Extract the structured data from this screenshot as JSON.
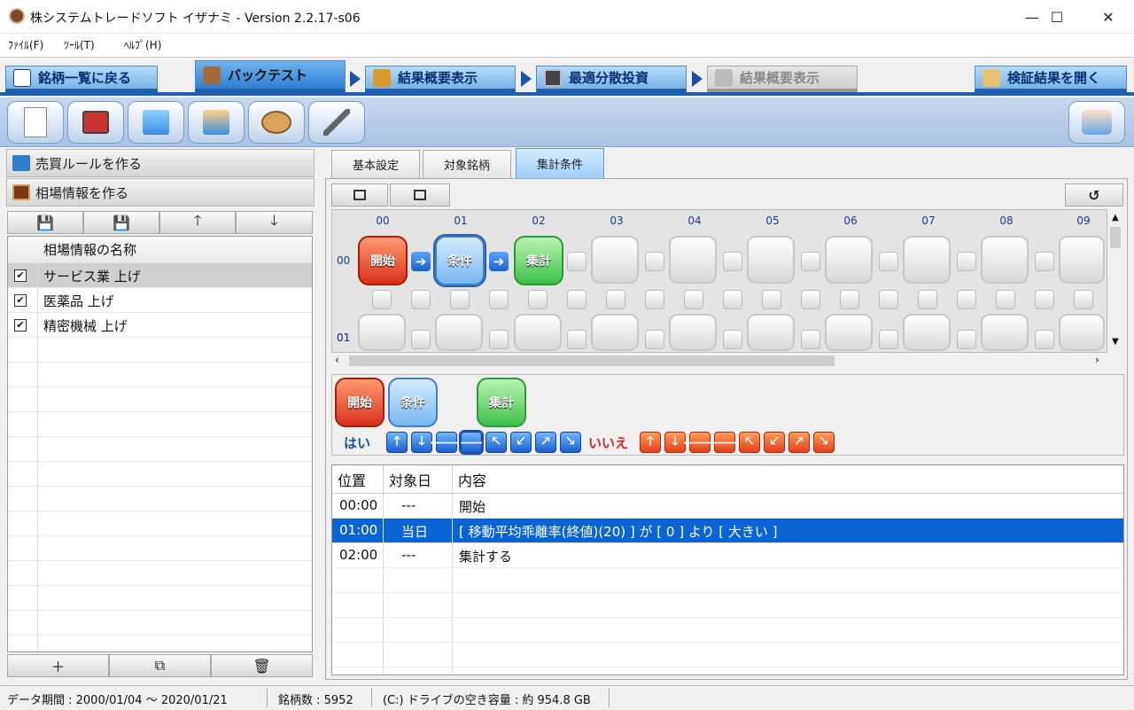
{
  "window": {
    "title": "株システムトレードソフト イザナミ - Version 2.2.17-s06",
    "minimize": "—",
    "maximize": "☐",
    "close": "✕"
  },
  "menu": [
    "ﾌｧｲﾙ(F)",
    "ﾂｰﾙ(T)",
    "ﾍﾙﾌﾟ(H)"
  ],
  "top_tabs": [
    {
      "label": "銘柄一覧に戻る",
      "state": "normal"
    },
    {
      "label": "バックテスト",
      "state": "active"
    },
    {
      "label": "結果概要表示",
      "state": "normal"
    },
    {
      "label": "最適分散投資",
      "state": "normal"
    },
    {
      "label": "結果概要表示",
      "state": "disabled"
    },
    {
      "label": "検証結果を開く",
      "state": "normal"
    }
  ],
  "toolbar": {
    "icons": [
      "new-document-icon",
      "export-icon",
      "upload-icon",
      "download-icon",
      "palette-icon",
      "tools-icon"
    ],
    "right_icon": "hand-button-icon"
  },
  "left": {
    "section1": "売買ルールを作る",
    "section2": "相場情報を作る",
    "list_buttons": [
      "💾",
      "💾",
      "🡑",
      "🡓"
    ],
    "column_header": "相場情報の名称",
    "rows": [
      {
        "checked": "✔",
        "name": "サービス業 上げ",
        "selected": true
      },
      {
        "checked": "✔",
        "name": "医薬品 上げ",
        "selected": false
      },
      {
        "checked": "✔",
        "name": "精密機械 上げ",
        "selected": false
      }
    ],
    "bottom_buttons": [
      "＋",
      "⧉",
      "🗑"
    ]
  },
  "right": {
    "tabs": [
      "基本設定",
      "対象銘柄",
      "集計条件"
    ],
    "active_tab": "集計条件",
    "undo_icon": "↺",
    "col_headers": [
      "00",
      "01",
      "02",
      "03",
      "04",
      "05",
      "06",
      "07",
      "08",
      "09"
    ],
    "row_headers": [
      "00",
      "01"
    ],
    "nodes": {
      "start": "開始",
      "cond": "条件",
      "sum": "集計"
    },
    "arrow_glyph": "➔",
    "palette": {
      "start": "開始",
      "cond": "条件",
      "sum": "集計",
      "yes": "はい",
      "no": "いいえ",
      "arrows": [
        "🡑",
        "🡓",
        "🡐",
        "🡒",
        "🡔",
        "🡗",
        "🡕",
        "🡖"
      ]
    },
    "table": {
      "headers": [
        "位置",
        "対象日",
        "内容"
      ],
      "rows": [
        {
          "pos": "00:00",
          "day": "---",
          "content": "開始",
          "selected": false
        },
        {
          "pos": "01:00",
          "day": "当日",
          "content": "[ 移動平均乖離率(終値)(20) ] が [ 0 ] より [ 大きい ]",
          "selected": true
        },
        {
          "pos": "02:00",
          "day": "---",
          "content": "集計する",
          "selected": false
        }
      ]
    }
  },
  "status": {
    "period": "データ期間 : 2000/01/04 〜 2020/01/21",
    "count": "銘柄数 : 5952",
    "disk": "(C:) ドライブの空き容量 : 約 954.8 GB"
  }
}
